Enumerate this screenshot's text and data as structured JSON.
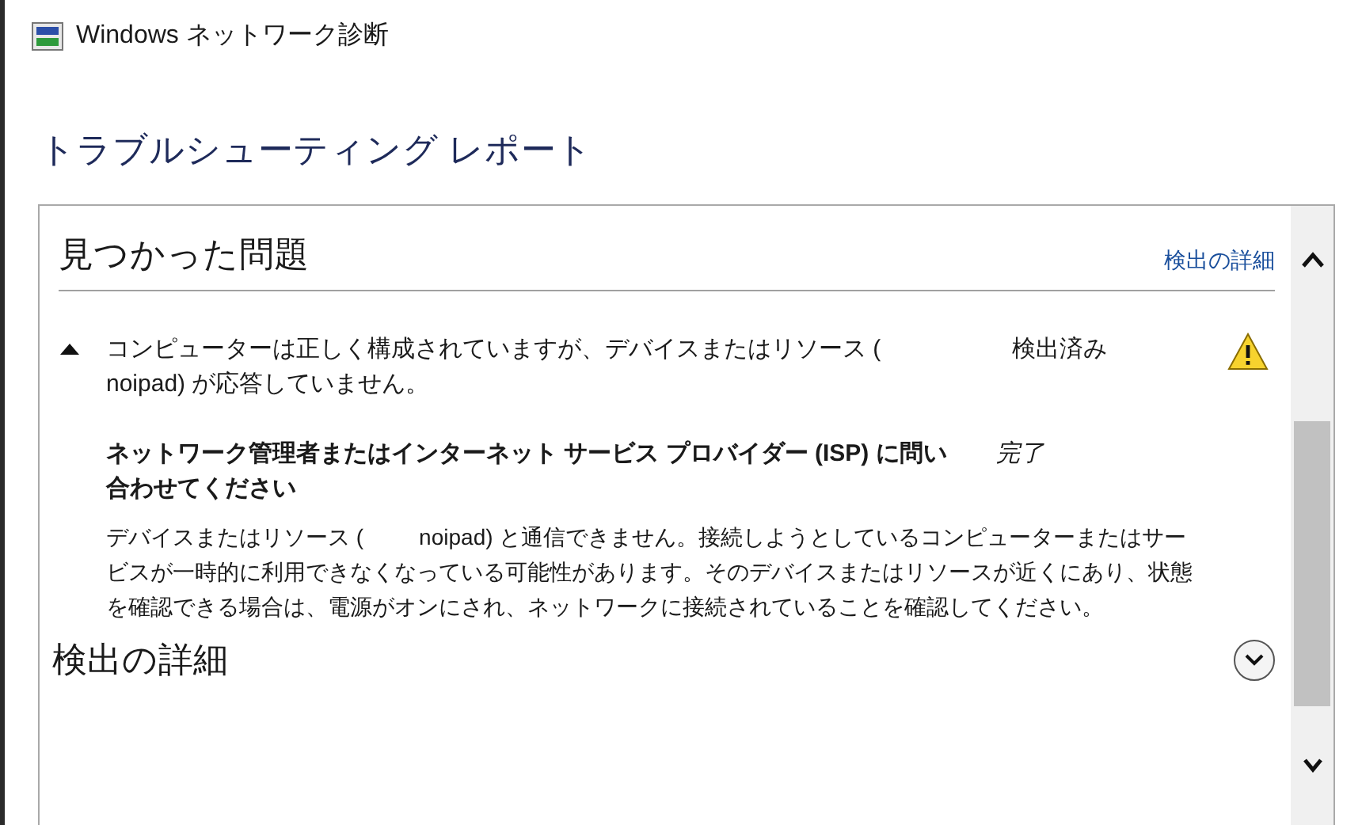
{
  "window": {
    "title": "Windows ネットワーク診断"
  },
  "heading": "トラブルシューティング レポート",
  "problems_section": {
    "title": "見つかった問題",
    "link": "検出の詳細"
  },
  "problems": [
    {
      "text": "コンピューターは正しく構成されていますが、デバイスまたはリソース (         noipad) が応答していません。",
      "status": "検出済み",
      "expanded": true,
      "actions": [
        {
          "title": "ネットワーク管理者またはインターネット サービス プロバイダー (ISP) に問い合わせてください",
          "status": "完了",
          "description": "デバイスまたはリソース (         noipad) と通信できません。接続しようとしているコンピューターまたはサービスが一時的に利用できなくなっている可能性があります。そのデバイスまたはリソースが近くにあり、状態を確認できる場合は、電源がオンにされ、ネットワークに接続されていることを確認してください。"
        }
      ]
    }
  ],
  "details_section": {
    "title": "検出の詳細",
    "expanded": false
  }
}
